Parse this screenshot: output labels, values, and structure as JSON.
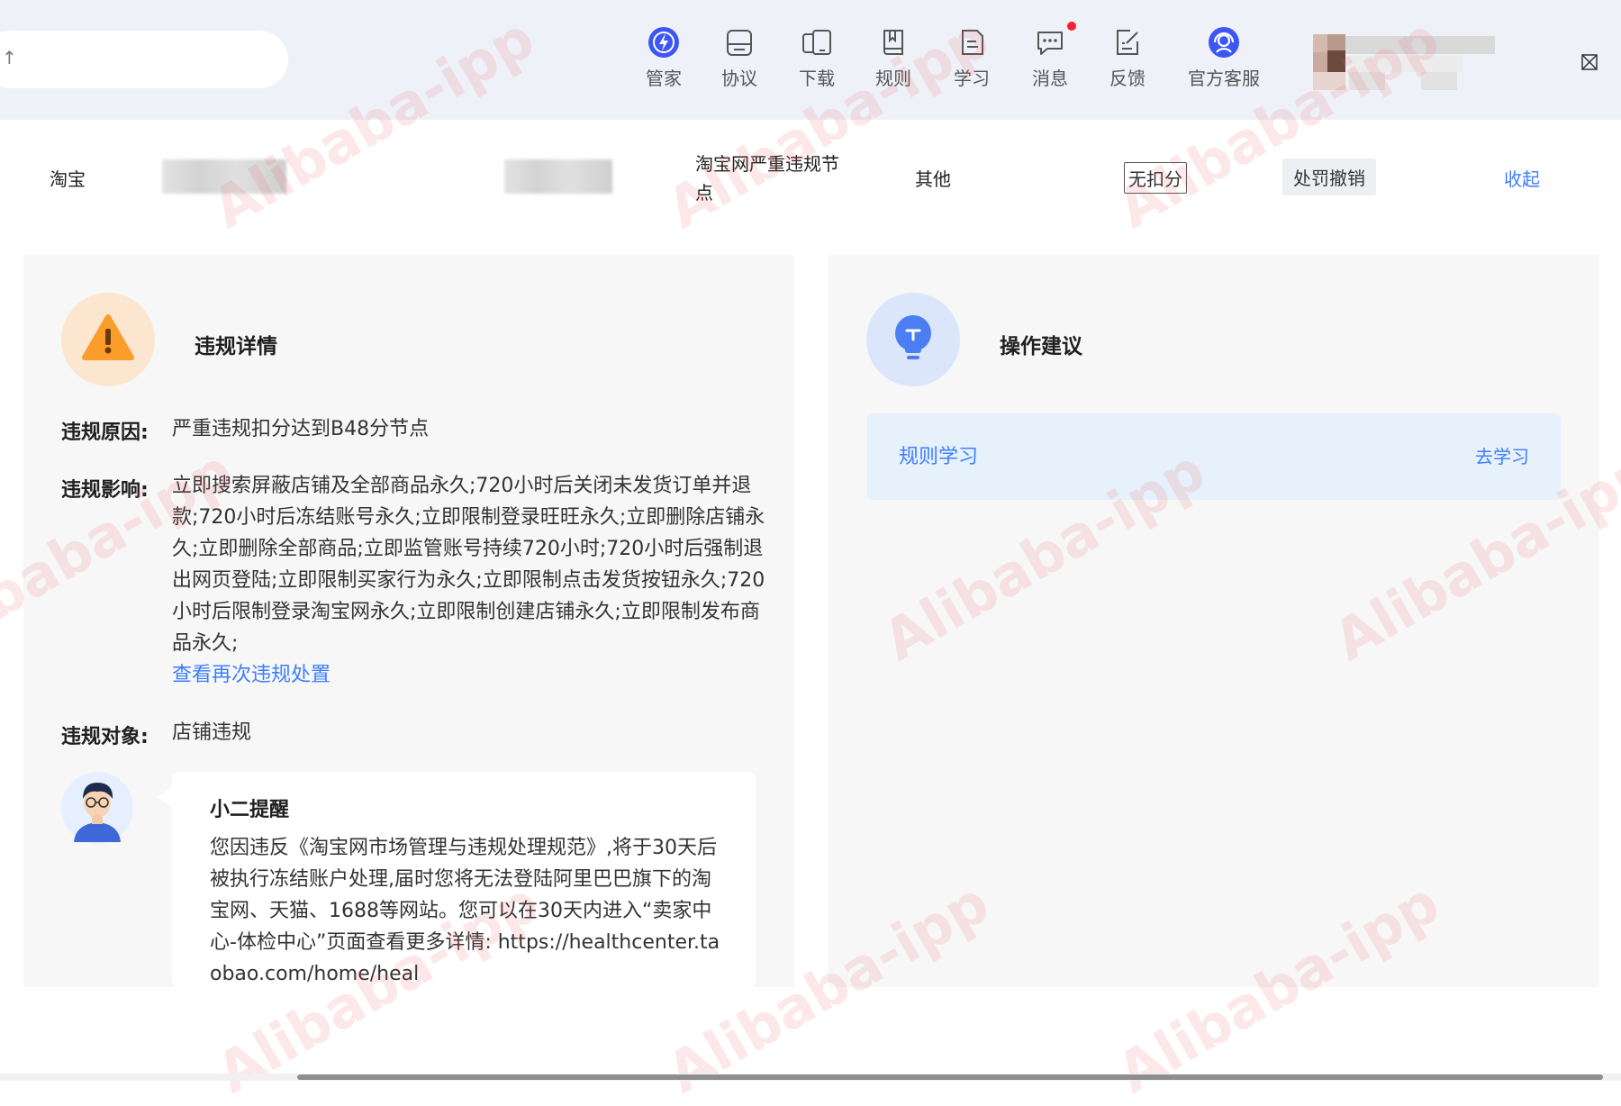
{
  "nav": {
    "items": [
      {
        "label": "管家",
        "icon": "butler-lightning-icon"
      },
      {
        "label": "协议",
        "icon": "agreement-icon"
      },
      {
        "label": "下载",
        "icon": "download-icon"
      },
      {
        "label": "规则",
        "icon": "rules-book-icon"
      },
      {
        "label": "学习",
        "icon": "learning-icon"
      },
      {
        "label": "消息",
        "icon": "message-icon",
        "badge": true
      },
      {
        "label": "反馈",
        "icon": "feedback-icon"
      },
      {
        "label": "官方客服",
        "icon": "customer-service-icon"
      }
    ],
    "accent": "#3d55f5"
  },
  "record": {
    "platform": "淘宝",
    "rule_node": "淘宝网严重违规节点",
    "category": "其他",
    "deduction_tag": "无扣分",
    "status_tag": "处罚撤销",
    "collapse_label": "收起"
  },
  "detail": {
    "title": "违规详情",
    "reason_label": "违规原因:",
    "reason_text": "严重违规扣分达到B48分节点",
    "impact_label": "违规影响:",
    "impact_text": "立即搜索屏蔽店铺及全部商品永久;720小时后关闭未发货订单并退款;720小时后冻结账号永久;立即限制登录旺旺永久;立即删除店铺永久;立即删除全部商品;立即监管账号持续720小时;720小时后强制退出网页登陆;立即限制买家行为永久;立即限制点击发货按钮永久;720小时后限制登录淘宝网永久;立即限制创建店铺永久;立即限制发布商品永久;",
    "impact_link": "查看再次违规处置",
    "target_label": "违规对象:",
    "target_text": "店铺违规",
    "tip_title": "小二提醒",
    "tip_text": "您因违反《淘宝网市场管理与违规处理规范》,将于30天后被执行冻结账户处理,届时您将无法登陆阿里巴巴旗下的淘宝网、天猫、1688等网站。您可以在30天内进入“卖家中心-体检中心”页面查看更多详情: https://healthcenter.taobao.com/home/heal"
  },
  "suggestion": {
    "title": "操作建议",
    "item_label": "规则学习",
    "item_action": "去学习"
  },
  "watermark": {
    "text": "Alibaba-ipp",
    "color": "#eb5a5a"
  }
}
